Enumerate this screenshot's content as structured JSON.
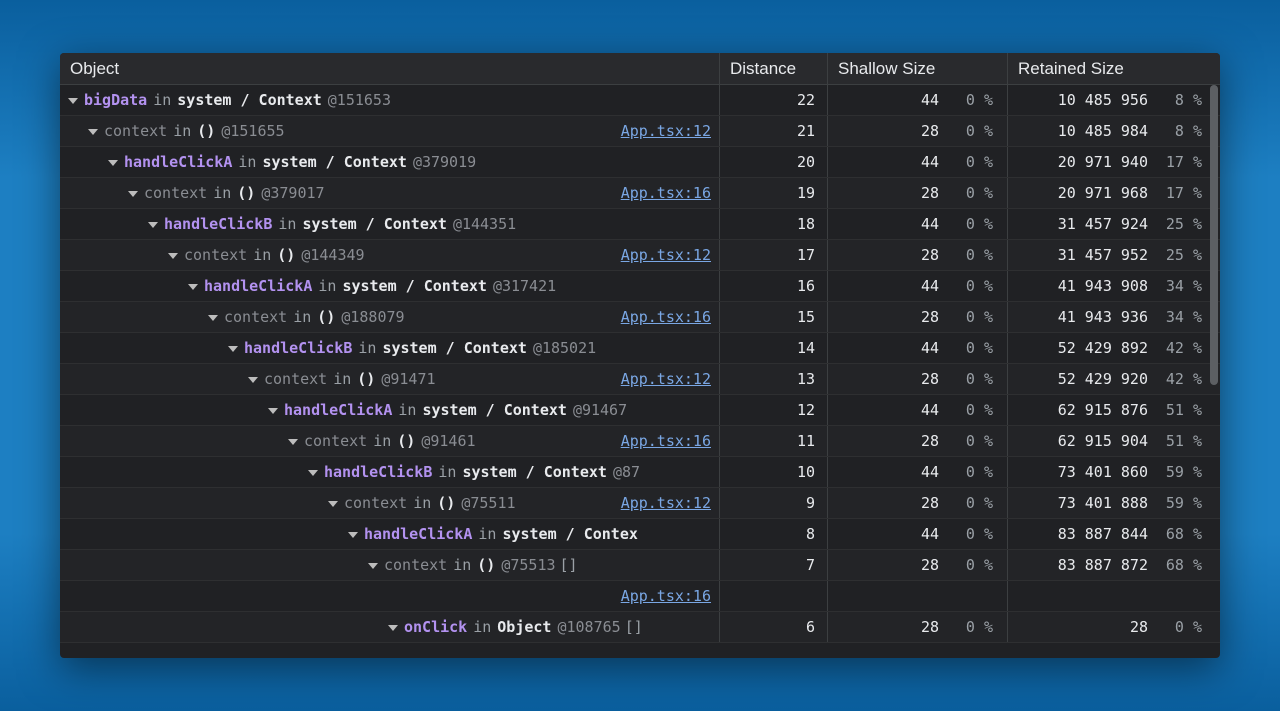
{
  "columns": {
    "object": "Object",
    "distance": "Distance",
    "shallow": "Shallow Size",
    "retained": "Retained Size"
  },
  "rows": [
    {
      "indent": 0,
      "prop": "bigData",
      "propStyle": "purple",
      "container": "system / Context",
      "addr": "@151653",
      "link": "",
      "distance": "22",
      "shallow": "44",
      "shallowPct": "0 %",
      "retained": "10 485 956",
      "retainedPct": "8 %"
    },
    {
      "indent": 1,
      "prop": "context",
      "propStyle": "dim",
      "container": "()",
      "addr": "@151655",
      "link": "App.tsx:12",
      "distance": "21",
      "shallow": "28",
      "shallowPct": "0 %",
      "retained": "10 485 984",
      "retainedPct": "8 %"
    },
    {
      "indent": 2,
      "prop": "handleClickA",
      "propStyle": "purple",
      "container": "system / Context",
      "addr": "@379019",
      "link": "",
      "distance": "20",
      "shallow": "44",
      "shallowPct": "0 %",
      "retained": "20 971 940",
      "retainedPct": "17 %"
    },
    {
      "indent": 3,
      "prop": "context",
      "propStyle": "dim",
      "container": "()",
      "addr": "@379017",
      "link": "App.tsx:16",
      "distance": "19",
      "shallow": "28",
      "shallowPct": "0 %",
      "retained": "20 971 968",
      "retainedPct": "17 %"
    },
    {
      "indent": 4,
      "prop": "handleClickB",
      "propStyle": "purple",
      "container": "system / Context",
      "addr": "@144351",
      "link": "",
      "distance": "18",
      "shallow": "44",
      "shallowPct": "0 %",
      "retained": "31 457 924",
      "retainedPct": "25 %"
    },
    {
      "indent": 5,
      "prop": "context",
      "propStyle": "dim",
      "container": "()",
      "addr": "@144349",
      "link": "App.tsx:12",
      "distance": "17",
      "shallow": "28",
      "shallowPct": "0 %",
      "retained": "31 457 952",
      "retainedPct": "25 %"
    },
    {
      "indent": 6,
      "prop": "handleClickA",
      "propStyle": "purple",
      "container": "system / Context",
      "addr": "@317421",
      "link": "",
      "distance": "16",
      "shallow": "44",
      "shallowPct": "0 %",
      "retained": "41 943 908",
      "retainedPct": "34 %"
    },
    {
      "indent": 7,
      "prop": "context",
      "propStyle": "dim",
      "container": "()",
      "addr": "@188079",
      "link": "App.tsx:16",
      "distance": "15",
      "shallow": "28",
      "shallowPct": "0 %",
      "retained": "41 943 936",
      "retainedPct": "34 %"
    },
    {
      "indent": 8,
      "prop": "handleClickB",
      "propStyle": "purple",
      "container": "system / Context",
      "addr": "@185021",
      "link": "",
      "distance": "14",
      "shallow": "44",
      "shallowPct": "0 %",
      "retained": "52 429 892",
      "retainedPct": "42 %"
    },
    {
      "indent": 9,
      "prop": "context",
      "propStyle": "dim",
      "container": "()",
      "addr": "@91471",
      "link": "App.tsx:12",
      "distance": "13",
      "shallow": "28",
      "shallowPct": "0 %",
      "retained": "52 429 920",
      "retainedPct": "42 %"
    },
    {
      "indent": 10,
      "prop": "handleClickA",
      "propStyle": "purple",
      "container": "system / Context",
      "addr": "@91467",
      "link": "",
      "distance": "12",
      "shallow": "44",
      "shallowPct": "0 %",
      "retained": "62 915 876",
      "retainedPct": "51 %"
    },
    {
      "indent": 11,
      "prop": "context",
      "propStyle": "dim",
      "container": "()",
      "addr": "@91461",
      "link": "App.tsx:16",
      "distance": "11",
      "shallow": "28",
      "shallowPct": "0 %",
      "retained": "62 915 904",
      "retainedPct": "51 %"
    },
    {
      "indent": 12,
      "prop": "handleClickB",
      "propStyle": "purple",
      "container": "system / Context",
      "addr": "@87",
      "link": "",
      "distance": "10",
      "shallow": "44",
      "shallowPct": "0 %",
      "retained": "73 401 860",
      "retainedPct": "59 %"
    },
    {
      "indent": 13,
      "prop": "context",
      "propStyle": "dim",
      "container": "()",
      "addr": "@75511",
      "link": "App.tsx:12",
      "distance": "9",
      "shallow": "28",
      "shallowPct": "0 %",
      "retained": "73 401 888",
      "retainedPct": "59 %"
    },
    {
      "indent": 14,
      "prop": "handleClickA",
      "propStyle": "purple",
      "container": "system / Contex",
      "addr": "",
      "link": "",
      "distance": "8",
      "shallow": "44",
      "shallowPct": "0 %",
      "retained": "83 887 844",
      "retainedPct": "68 %"
    },
    {
      "indent": 15,
      "prop": "context",
      "propStyle": "dim",
      "container": "()",
      "addr": "@75513",
      "link": "",
      "trailingSquare": true,
      "distance": "7",
      "shallow": "28",
      "shallowPct": "0 %",
      "retained": "83 887 872",
      "retainedPct": "68 %"
    },
    {
      "indent": 15,
      "prop": "",
      "propStyle": "dim",
      "container": "",
      "addr": "",
      "linkOnlyRight": "App.tsx:16",
      "distance": "",
      "shallow": "",
      "shallowPct": "",
      "retained": "",
      "retainedPct": ""
    },
    {
      "indent": 16,
      "prop": "onClick",
      "propStyle": "purple",
      "container": "Object",
      "addr": "@108765",
      "link": "",
      "trailingSquare": true,
      "distance": "6",
      "shallow": "28",
      "shallowPct": "0 %",
      "retained": "28",
      "retainedPct": "0 %"
    }
  ]
}
